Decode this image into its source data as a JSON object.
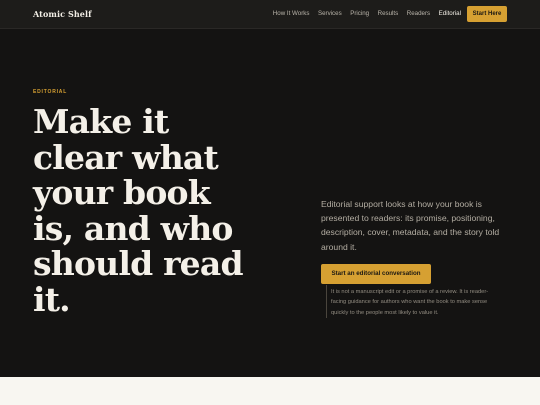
{
  "brand": "Atomic Shelf",
  "nav": {
    "links": [
      "How It Works",
      "Services",
      "Pricing",
      "Results",
      "Readers",
      "Editorial"
    ],
    "active": "Editorial",
    "cta": "Start Here"
  },
  "hero": {
    "eyebrow": "EDITORIAL",
    "headline": "Make it clear what your book is, and who should read it.",
    "lede": "Editorial support looks at how your book is presented to readers: its promise, positioning, description, cover, metadata, and the story told around it.",
    "cta": "Start an editorial conversation",
    "note": "It is not a manuscript edit or a promise of a review. It is reader-facing guidance for authors who want the book to make sense quickly to the people most likely to value it."
  }
}
